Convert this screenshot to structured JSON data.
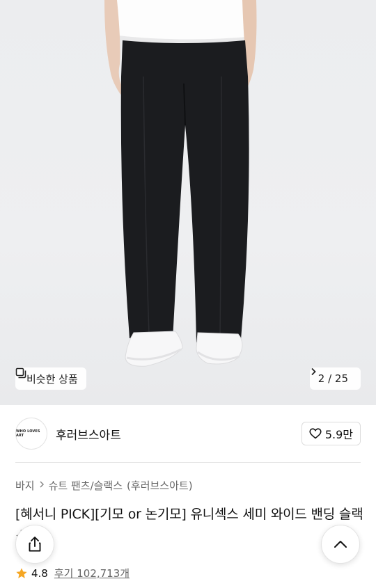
{
  "hero": {
    "similar_label": "비슷한 상품",
    "pager": "2 / 25"
  },
  "brand": {
    "logo_text": "WHO LOVES ART",
    "name": "후러브스아트",
    "likes": "5.9만"
  },
  "breadcrumb": {
    "category": "바지",
    "subcategory": "슈트 팬츠/슬랙스",
    "brand": "(후러브스아트)"
  },
  "product": {
    "title": "[혜서니 PICK][기모 or 논기모] 유니섹스 세미 와이드 밴딩 슬랙스"
  },
  "rating": {
    "score": "4.8",
    "reviews": "후기 102,713개"
  },
  "colors": {
    "star": "#f5a623",
    "pants": "#1b1c1f",
    "shirt": "#ffffff"
  }
}
